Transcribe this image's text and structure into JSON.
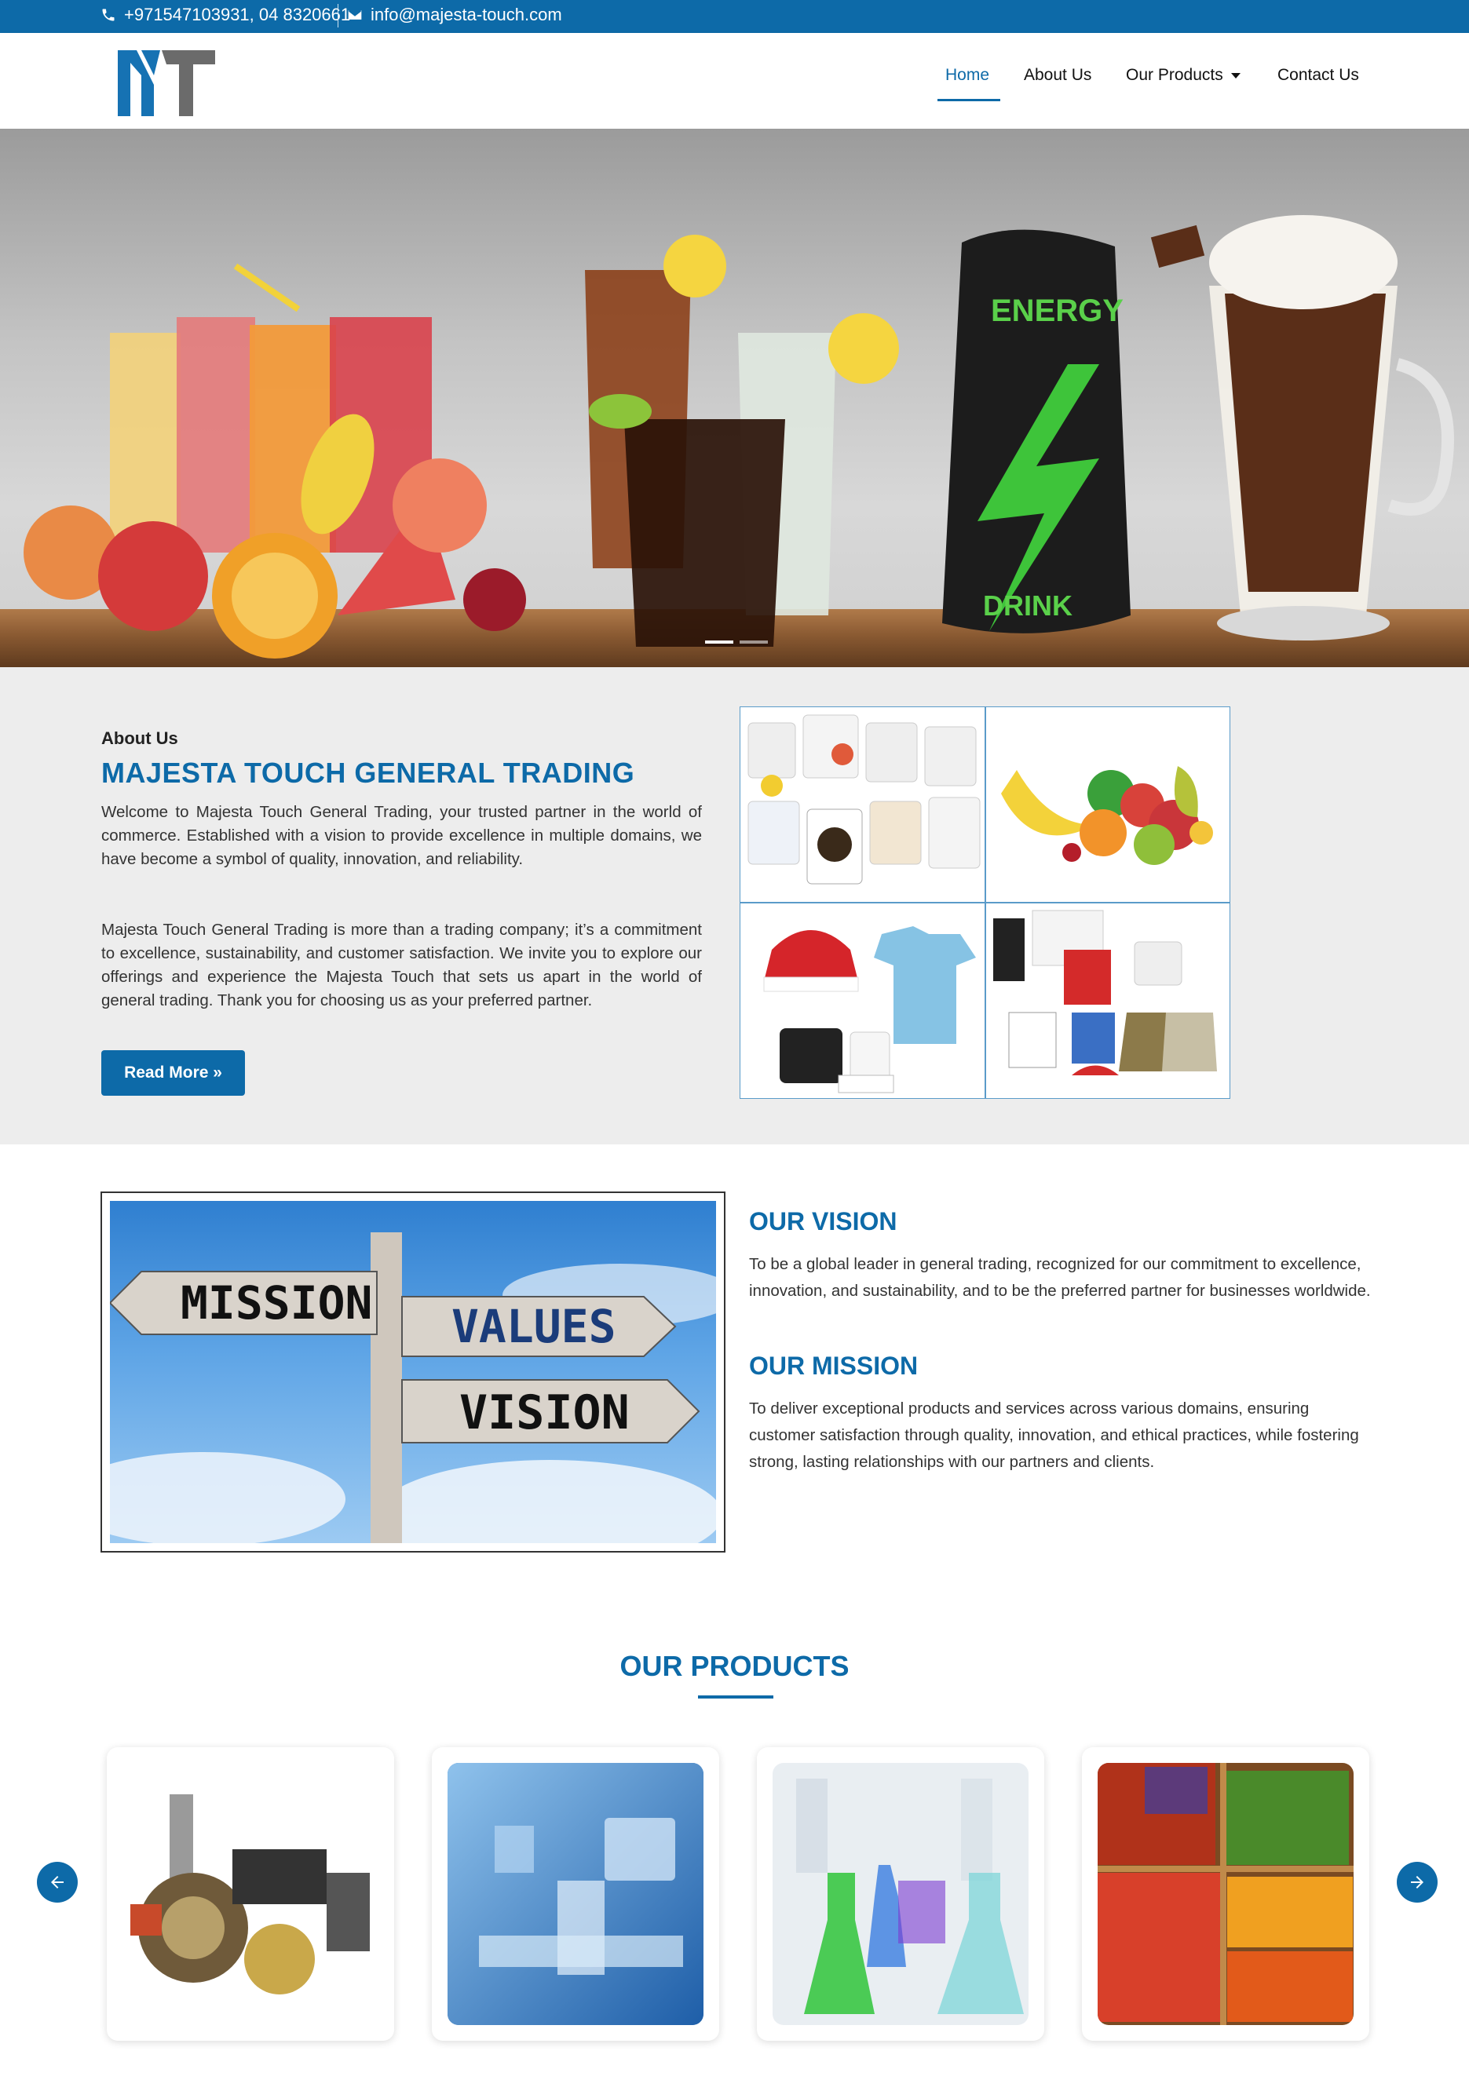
{
  "topbar": {
    "phone": "+971547103931, 04 8320661",
    "email": "info@majesta-touch.com"
  },
  "nav": {
    "items": [
      "Home",
      "About Us",
      "Our Products",
      "Contact Us"
    ],
    "active": "Home"
  },
  "hero": {
    "can_text_top": "ENERGY",
    "can_text_bottom": "DRINK",
    "slide_count": 2,
    "active_slide": 1
  },
  "about": {
    "kicker": "About Us",
    "title": "MAJESTA TOUCH GENERAL TRADING",
    "p1": "Welcome to Majesta Touch General Trading, your trusted partner in the world of commerce. Established with a vision to provide excellence in multiple domains, we have become a symbol of quality, innovation, and reliability.",
    "p2": "Majesta Touch General Trading is more than a trading company; it’s a commitment to excellence, sustainability, and customer satisfaction. We invite you to explore our offerings and experience the Majesta Touch that sets us apart in the world of general trading. Thank you for choosing us as your preferred partner.",
    "button": "Read More »"
  },
  "vision": {
    "sign_mission": "MISSION",
    "sign_values": "VALUES",
    "sign_vision": "VISION",
    "vision_heading": "OUR VISION",
    "vision_text": "To be a global leader in general trading, recognized for our commitment to excellence, innovation, and sustainability, and to be the preferred partner for businesses worldwide.",
    "mission_heading": "OUR MISSION",
    "mission_text": "To deliver exceptional products and services across various domains, ensuring customer satisfaction through quality, innovation, and ethical practices, while fostering strong, lasting relationships with our partners and clients."
  },
  "products": {
    "heading": "OUR PRODUCTS",
    "cards": [
      "auto-parts",
      "medical-equipment",
      "laboratory-chemicals",
      "fresh-vegetables"
    ]
  },
  "colors": {
    "brand": "#0d6aa8",
    "about_bg": "#ededed"
  }
}
